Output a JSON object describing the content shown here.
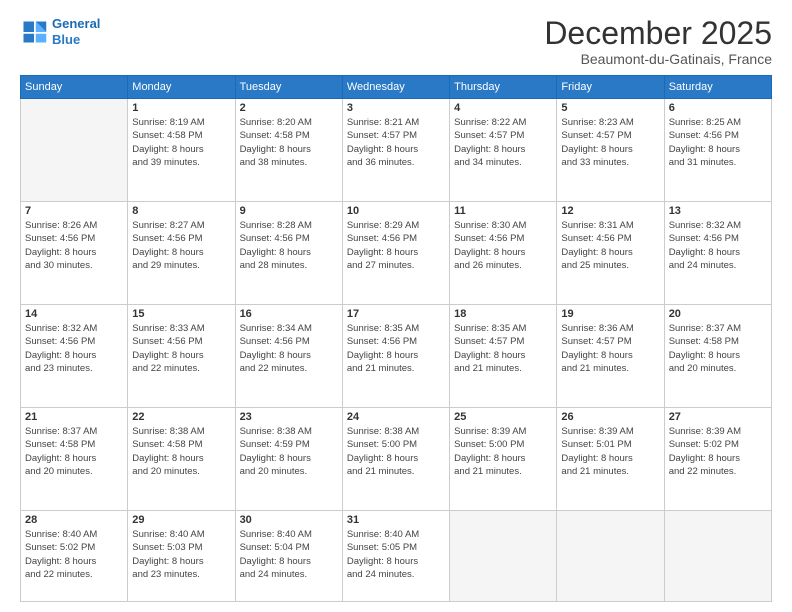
{
  "logo": {
    "line1": "General",
    "line2": "Blue"
  },
  "header": {
    "month": "December 2025",
    "location": "Beaumont-du-Gatinais, France"
  },
  "weekdays": [
    "Sunday",
    "Monday",
    "Tuesday",
    "Wednesday",
    "Thursday",
    "Friday",
    "Saturday"
  ],
  "weeks": [
    [
      {
        "day": "",
        "empty": true
      },
      {
        "day": "1",
        "sunrise": "8:19 AM",
        "sunset": "4:58 PM",
        "daylight": "8 hours and 39 minutes."
      },
      {
        "day": "2",
        "sunrise": "8:20 AM",
        "sunset": "4:58 PM",
        "daylight": "8 hours and 38 minutes."
      },
      {
        "day": "3",
        "sunrise": "8:21 AM",
        "sunset": "4:57 PM",
        "daylight": "8 hours and 36 minutes."
      },
      {
        "day": "4",
        "sunrise": "8:22 AM",
        "sunset": "4:57 PM",
        "daylight": "8 hours and 34 minutes."
      },
      {
        "day": "5",
        "sunrise": "8:23 AM",
        "sunset": "4:57 PM",
        "daylight": "8 hours and 33 minutes."
      },
      {
        "day": "6",
        "sunrise": "8:25 AM",
        "sunset": "4:56 PM",
        "daylight": "8 hours and 31 minutes."
      }
    ],
    [
      {
        "day": "7",
        "sunrise": "8:26 AM",
        "sunset": "4:56 PM",
        "daylight": "8 hours and 30 minutes."
      },
      {
        "day": "8",
        "sunrise": "8:27 AM",
        "sunset": "4:56 PM",
        "daylight": "8 hours and 29 minutes."
      },
      {
        "day": "9",
        "sunrise": "8:28 AM",
        "sunset": "4:56 PM",
        "daylight": "8 hours and 28 minutes."
      },
      {
        "day": "10",
        "sunrise": "8:29 AM",
        "sunset": "4:56 PM",
        "daylight": "8 hours and 27 minutes."
      },
      {
        "day": "11",
        "sunrise": "8:30 AM",
        "sunset": "4:56 PM",
        "daylight": "8 hours and 26 minutes."
      },
      {
        "day": "12",
        "sunrise": "8:31 AM",
        "sunset": "4:56 PM",
        "daylight": "8 hours and 25 minutes."
      },
      {
        "day": "13",
        "sunrise": "8:32 AM",
        "sunset": "4:56 PM",
        "daylight": "8 hours and 24 minutes."
      }
    ],
    [
      {
        "day": "14",
        "sunrise": "8:32 AM",
        "sunset": "4:56 PM",
        "daylight": "8 hours and 23 minutes."
      },
      {
        "day": "15",
        "sunrise": "8:33 AM",
        "sunset": "4:56 PM",
        "daylight": "8 hours and 22 minutes."
      },
      {
        "day": "16",
        "sunrise": "8:34 AM",
        "sunset": "4:56 PM",
        "daylight": "8 hours and 22 minutes."
      },
      {
        "day": "17",
        "sunrise": "8:35 AM",
        "sunset": "4:56 PM",
        "daylight": "8 hours and 21 minutes."
      },
      {
        "day": "18",
        "sunrise": "8:35 AM",
        "sunset": "4:57 PM",
        "daylight": "8 hours and 21 minutes."
      },
      {
        "day": "19",
        "sunrise": "8:36 AM",
        "sunset": "4:57 PM",
        "daylight": "8 hours and 21 minutes."
      },
      {
        "day": "20",
        "sunrise": "8:37 AM",
        "sunset": "4:58 PM",
        "daylight": "8 hours and 20 minutes."
      }
    ],
    [
      {
        "day": "21",
        "sunrise": "8:37 AM",
        "sunset": "4:58 PM",
        "daylight": "8 hours and 20 minutes."
      },
      {
        "day": "22",
        "sunrise": "8:38 AM",
        "sunset": "4:58 PM",
        "daylight": "8 hours and 20 minutes."
      },
      {
        "day": "23",
        "sunrise": "8:38 AM",
        "sunset": "4:59 PM",
        "daylight": "8 hours and 20 minutes."
      },
      {
        "day": "24",
        "sunrise": "8:38 AM",
        "sunset": "5:00 PM",
        "daylight": "8 hours and 21 minutes."
      },
      {
        "day": "25",
        "sunrise": "8:39 AM",
        "sunset": "5:00 PM",
        "daylight": "8 hours and 21 minutes."
      },
      {
        "day": "26",
        "sunrise": "8:39 AM",
        "sunset": "5:01 PM",
        "daylight": "8 hours and 21 minutes."
      },
      {
        "day": "27",
        "sunrise": "8:39 AM",
        "sunset": "5:02 PM",
        "daylight": "8 hours and 22 minutes."
      }
    ],
    [
      {
        "day": "28",
        "sunrise": "8:40 AM",
        "sunset": "5:02 PM",
        "daylight": "8 hours and 22 minutes."
      },
      {
        "day": "29",
        "sunrise": "8:40 AM",
        "sunset": "5:03 PM",
        "daylight": "8 hours and 23 minutes."
      },
      {
        "day": "30",
        "sunrise": "8:40 AM",
        "sunset": "5:04 PM",
        "daylight": "8 hours and 24 minutes."
      },
      {
        "day": "31",
        "sunrise": "8:40 AM",
        "sunset": "5:05 PM",
        "daylight": "8 hours and 24 minutes."
      },
      {
        "day": "",
        "empty": true
      },
      {
        "day": "",
        "empty": true
      },
      {
        "day": "",
        "empty": true
      }
    ]
  ]
}
